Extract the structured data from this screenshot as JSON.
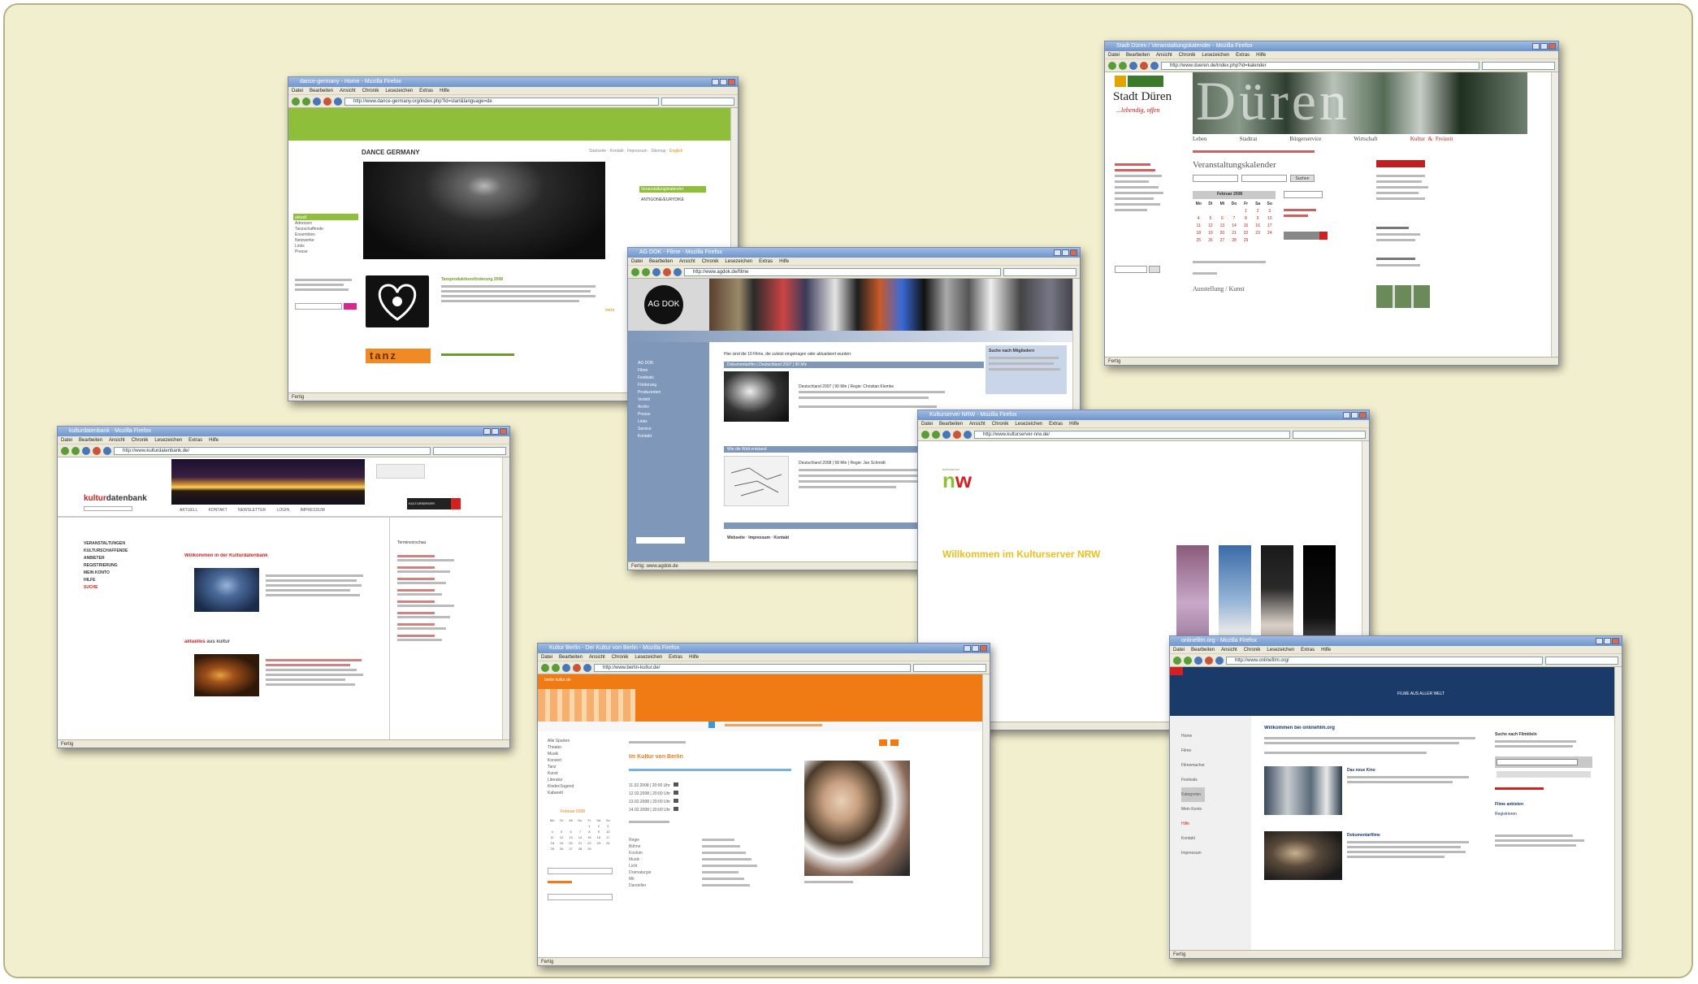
{
  "windows": [
    {
      "id": "dance",
      "title": "dance-germany - Home - Mozilla Firefox",
      "url": "http://www.dance-germany.org/index.php?id=start&language=de",
      "menu": [
        "Datei",
        "Bearbeiten",
        "Ansicht",
        "Chronik",
        "Lesezeichen",
        "Extras",
        "Hilfe"
      ],
      "page": {
        "site_name": "DANCE GERMANY",
        "nav_top": [
          "Startseite",
          "Kontakt",
          "Impressum",
          "Sitemap",
          "English"
        ],
        "sidebar": [
          "aktuell",
          "Adressen",
          "Tanzschaffende",
          "Ensembles",
          "Netzwerke",
          "Links",
          "Presse"
        ],
        "news_title": "Tanzproduktionsförderung 2008",
        "news_link": "mehr",
        "box_title": "Veranstaltungskalender",
        "box_text": "ANTIGONE/EURYDIKE",
        "logo_text": "tanz"
      },
      "status": "Fertig"
    },
    {
      "id": "duren",
      "title": "Stadt Düren / Veranstaltungskalender - Mozilla Firefox",
      "url": "http://www.dueren.de/index.php?id=kalender",
      "menu": [
        "Datei",
        "Bearbeiten",
        "Ansicht",
        "Chronik",
        "Lesezeichen",
        "Extras",
        "Hilfe"
      ],
      "page": {
        "city": "Stadt Düren",
        "tagline": "...lebendig, offen",
        "banner_text": "Düren",
        "nav": [
          "Leben",
          "Stadtrat",
          "Bürgerservice",
          "Wirtschaft",
          "Kultur & Freizeit"
        ],
        "heading": "Veranstaltungskalender",
        "month": "Februar 2008",
        "weekdays": [
          "Mo",
          "Di",
          "Mi",
          "Do",
          "Fr",
          "Sa",
          "So"
        ],
        "days": [
          "",
          "",
          "",
          "",
          "1",
          "2",
          "3",
          "4",
          "5",
          "6",
          "7",
          "8",
          "9",
          "10",
          "11",
          "12",
          "13",
          "14",
          "15",
          "16",
          "17",
          "18",
          "19",
          "20",
          "21",
          "22",
          "23",
          "24",
          "25",
          "26",
          "27",
          "28",
          "29",
          "",
          ""
        ],
        "sub_heading": "Ausstellung / Kunst",
        "search_button": "Suchen"
      },
      "status": "Fertig"
    },
    {
      "id": "agdok",
      "title": "AG DOK - Filme - Mozilla Firefox",
      "url": "http://www.agdok.de/filme",
      "menu": [
        "Datei",
        "Bearbeiten",
        "Ansicht",
        "Chronik",
        "Lesezeichen",
        "Extras",
        "Hilfe"
      ],
      "page": {
        "logo": "AG DOK",
        "intro": "Hier sind die 10 Filme, die zuletzt eingetragen oder aktualisiert wurden:",
        "film1_bar": "Dokumentarfilm | Deutschland 2007 | 90 Min",
        "film1_text": "Deutschland 2007 | 90 Min | Regie: Christian Klemke",
        "film2_bar": "Wie die Welt entstand",
        "film2_text": "Deutschland 2008 | 58 Min | Regie: Jan Schmidt",
        "sidebar": [
          "AG DOK",
          "Filme",
          "Festivals",
          "Förderung",
          "Produzenten",
          "Verleih",
          "Archiv",
          "Presse",
          "Links",
          "Service",
          "Kontakt"
        ],
        "box_title": "Suche nach Mitgliedern",
        "footer": "Webseite · Impressum · Kontakt"
      },
      "status": "Fertig: www.agdok.de"
    },
    {
      "id": "kdb",
      "title": "kulturdatenbank - Mozilla Firefox",
      "url": "http://www.kulturdatenbank.de/",
      "menu": [
        "Datei",
        "Bearbeiten",
        "Ansicht",
        "Chronik",
        "Lesezeichen",
        "Extras",
        "Hilfe"
      ],
      "page": {
        "logo_a": "kultur",
        "logo_b": "datenbank",
        "nav": [
          "AKTUELL",
          "KONTAKT",
          "NEWSLETTER",
          "LOGIN",
          "IMPRESSUM"
        ],
        "left_nav": [
          "VERANSTALTUNGEN",
          "KULTURSCHAFFENDE",
          "ANBIETER",
          "",
          "REGISTRIERUNG",
          "MEIN KONTO",
          "HILFE",
          "SUCHE"
        ],
        "welcome": "Willkommen in der Kulturdatenbank",
        "section_a": "aktuelles",
        "section_b": "aus kultur",
        "right_title": "Terminvorschau",
        "badge": "KULTURSERVER"
      },
      "status": "Fertig"
    },
    {
      "id": "nrw",
      "title": "Kulturserver NRW - Mozilla Firefox",
      "url": "http://www.kulturserver-nrw.de/",
      "menu": [
        "Datei",
        "Bearbeiten",
        "Ansicht",
        "Chronik",
        "Lesezeichen",
        "Extras",
        "Hilfe"
      ],
      "page": {
        "logo_small": "kulturserver",
        "logo_a": "n",
        "logo_b": "w",
        "welcome": "Willkommen im Kulturserver NRW"
      },
      "status": ""
    },
    {
      "id": "berlin",
      "title": "Kultur Berlin - Der Kultur von Berlin - Mozilla Firefox",
      "url": "http://www.berlin-kultur.de/",
      "menu": [
        "Datei",
        "Bearbeiten",
        "Ansicht",
        "Chronik",
        "Lesezeichen",
        "Extras",
        "Hilfe"
      ],
      "page": {
        "header": "berlin kultur.de",
        "page_title": "Im Kultur von Berlin",
        "left_nav": [
          "Alle Sparten",
          "Theater",
          "Musik",
          "Konzert",
          "Tanz",
          "Kunst",
          "Literatur",
          "Kinder/Jugend",
          "Kabarett"
        ],
        "month": "Februar 2008",
        "dates": [
          "11.02.2008 | 20:00 Uhr",
          "12.02.2008 | 20:00 Uhr",
          "13.02.2008 | 20:00 Uhr",
          "14.02.2008 | 20:00 Uhr"
        ],
        "credits": [
          "Regie",
          "Bühne",
          "Kostüm",
          "Musik",
          "Licht",
          "Dramaturgie",
          "Mit",
          "Darsteller"
        ]
      },
      "status": "Fertig"
    },
    {
      "id": "onlinefilm",
      "title": "onlinefilm.org - Mozilla Firefox",
      "url": "http://www.onlinefilm.org/",
      "menu": [
        "Datei",
        "Bearbeiten",
        "Ansicht",
        "Chronik",
        "Lesezeichen",
        "Extras",
        "Hilfe"
      ],
      "page": {
        "header": "FILME AUS ALLER WELT",
        "welcome": "Willkommen bei onlinefilm.org",
        "film1": "Das neue Kino",
        "film2": "Dokumentarfilme",
        "left_nav": [
          "Home",
          "Filme",
          "Filmemacher",
          "Festivals",
          "Kategorien",
          "Mein Konto",
          "Hilfe",
          "Kontakt",
          "Impressum"
        ],
        "right_title": "Suche nach Filmtiteln",
        "right_b": "Filme anbieten",
        "right_c": "Registrieren"
      },
      "status": "Fertig"
    }
  ]
}
